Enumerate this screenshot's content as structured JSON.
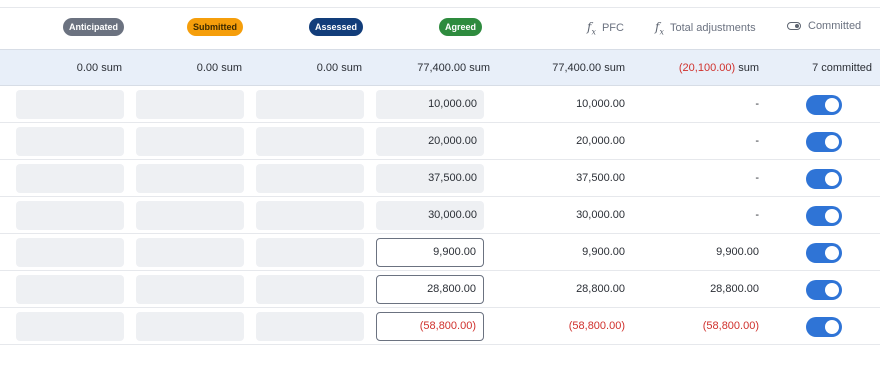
{
  "header": {
    "anticipated": {
      "label": "Anticipated",
      "bg": "#6b7280",
      "fg": "#ffffff"
    },
    "submitted": {
      "label": "Submitted",
      "bg": "#f59e0b",
      "fg": "#3b2a00"
    },
    "assessed": {
      "label": "Assessed",
      "bg": "#123d7a",
      "fg": "#ffffff"
    },
    "agreed": {
      "label": "Agreed",
      "bg": "#2e8b3e",
      "fg": "#ffffff"
    },
    "pfc_label": "PFC",
    "pfc_icon": "fx-formula-icon",
    "total_adjustments_label": "Total adjustments",
    "total_adjustments_icon": "fx-formula-icon",
    "committed_label": "Committed",
    "committed_icon": "toggle-icon"
  },
  "summary": {
    "anticipated": "0.00 sum",
    "submitted": "0.00 sum",
    "assessed": "0.00 sum",
    "agreed": "77,400.00 sum",
    "pfc": "77,400.00 sum",
    "total_adjustments_value": "(20,100.00)",
    "total_adjustments_suffix": " sum",
    "committed": "7 committed"
  },
  "rows": [
    {
      "agreed": "10,000.00",
      "pfc": "10,000.00",
      "adjustment": "-",
      "committed": true
    },
    {
      "agreed": "20,000.00",
      "pfc": "20,000.00",
      "adjustment": "-",
      "committed": true
    },
    {
      "agreed": "37,500.00",
      "pfc": "37,500.00",
      "adjustment": "-",
      "committed": true
    },
    {
      "agreed": "30,000.00",
      "pfc": "30,000.00",
      "adjustment": "-",
      "committed": true
    },
    {
      "agreed": "9,900.00",
      "pfc": "9,900.00",
      "adjustment": "9,900.00",
      "committed": true
    },
    {
      "agreed": "28,800.00",
      "pfc": "28,800.00",
      "adjustment": "28,800.00",
      "committed": true
    },
    {
      "agreed": "(58,800.00)",
      "pfc": "(58,800.00)",
      "adjustment": "(58,800.00)",
      "committed": true
    }
  ],
  "colors": {
    "summary_bg": "#e8eff9",
    "negative": "#d0312d",
    "toggle_on": "#2f74d6"
  }
}
